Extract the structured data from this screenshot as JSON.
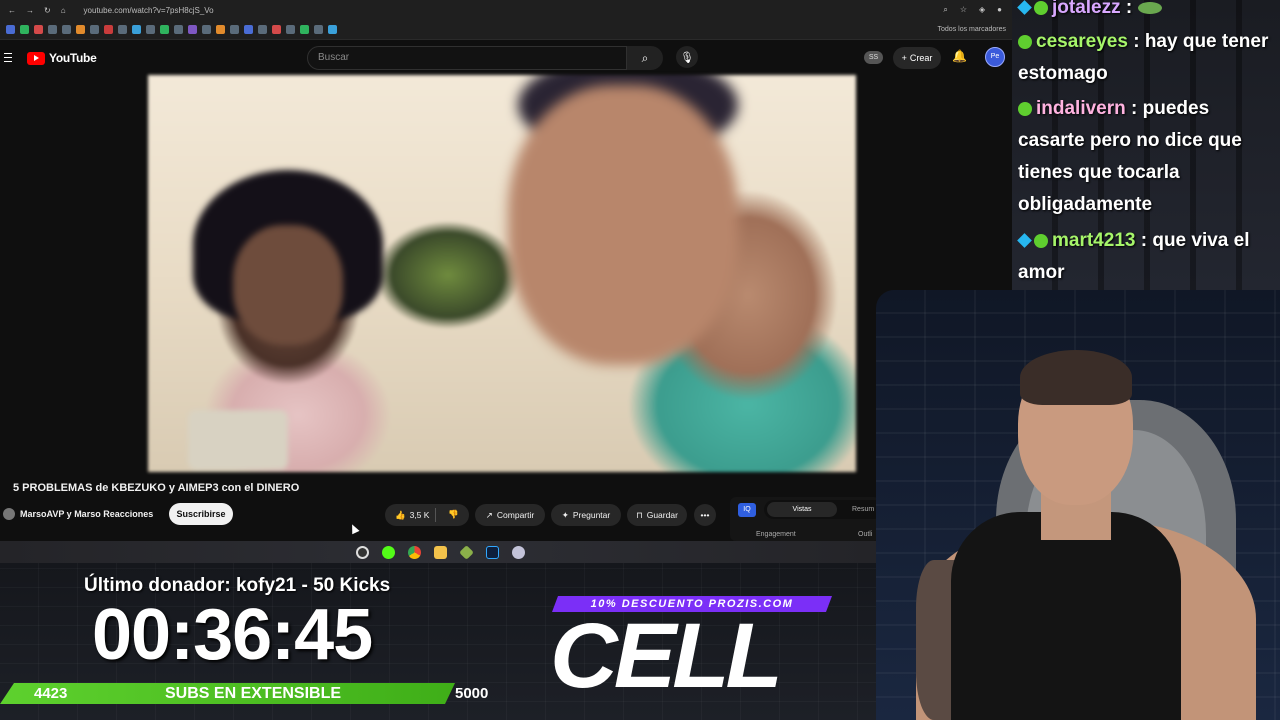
{
  "browser": {
    "url": "youtube.com/watch?v=7psH8cjS_Vo",
    "bookmarks_folder": "Todos los marcadores"
  },
  "youtube": {
    "logo_text": "YouTube",
    "search_placeholder": "Buscar",
    "badge": "SS",
    "create_label": "Crear",
    "avatar_text": "Pe"
  },
  "video": {
    "title": "5 PROBLEMAS de KBEZUKO y AIMEP3 con el DINERO",
    "channel": "MarsoAVP y Marso Reacciones",
    "subscribe_label": "Suscribirse",
    "likes": "3,5 K",
    "share_label": "Compartir",
    "ask_label": "Preguntar",
    "save_label": "Guardar"
  },
  "side_panel": {
    "icon_text": "IQ",
    "tab_active": "Vistas",
    "tab_other": "Resum",
    "label_left": "Engagement",
    "label_right": "Outli"
  },
  "chat": {
    "messages": [
      {
        "user": "jotalezz",
        "text": ":",
        "user_color": "#d9a8ff"
      },
      {
        "user": "cesareyes",
        "text": ": hay que tener estomago",
        "user_color": "#a6f56a"
      },
      {
        "user": "indalivern",
        "text": ": puedes casarte pero no dice que tienes que tocarla obligadamente",
        "user_color": "#ffb3e0"
      },
      {
        "user": "mart4213",
        "text": ": que viva el amor",
        "user_color": "#a6f56a"
      }
    ]
  },
  "overlay": {
    "donor": "Último donador: kofy21 - 50 Kicks",
    "timer": "00:36:45",
    "subs_current": "4423",
    "subs_label": "SUBS EN EXTENSIBLE",
    "subs_goal": "5000",
    "subs_progress": 0.885,
    "promo": "10% DESCUENTO PROZIS.COM",
    "code": "CELL"
  },
  "colors": {
    "youtube_red": "#ff0000",
    "sub_bar_green": "#5ed12e",
    "promo_purple": "#7b2ff7"
  }
}
